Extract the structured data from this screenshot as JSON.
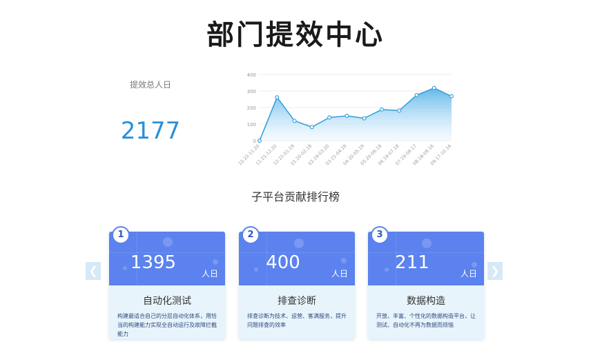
{
  "page": {
    "title": "部门提效中心"
  },
  "summary": {
    "label": "提效总人日",
    "total": "2177"
  },
  "chart_data": {
    "type": "area",
    "x": [
      "10.22-11.20",
      "11.21-12.20",
      "12.21-01.19",
      "01.20-02.18",
      "02.19-03.20",
      "03.21-04.19",
      "04.20-05.19",
      "05.20-06.18",
      "06.19-07.18",
      "07.19-08.17",
      "08.18-09.16",
      "09.17-10.16"
    ],
    "series": [
      {
        "values": [
          0,
          262,
          120,
          82,
          140,
          150,
          135,
          188,
          182,
          275,
          318,
          268
        ]
      }
    ],
    "yticks": [
      "0",
      "100",
      "200",
      "300",
      "400"
    ],
    "ylim": [
      0,
      400
    ],
    "grid": true,
    "colors": {
      "line": "#3aa0dc",
      "fill_top": "#4fb0e8",
      "fill_bottom": "#e6f4fc",
      "point_fill": "#ffffff"
    }
  },
  "ranking": {
    "title": "子平台贡献排行榜",
    "prev_icon": "chevron-left-icon",
    "next_icon": "chevron-right-icon",
    "cards": [
      {
        "rank": "1",
        "value": "1395",
        "unit": "人日",
        "name": "自动化测试",
        "desc": "构建最适合自己的分层自动化体系，用恰当的构建能力实现全自动运行及故障拦截能力"
      },
      {
        "rank": "2",
        "value": "400",
        "unit": "人日",
        "name": "排查诊断",
        "desc": "排查诊断为技术、运营、客满服务，提升问题排查的效率"
      },
      {
        "rank": "3",
        "value": "211",
        "unit": "人日",
        "name": "数据构造",
        "desc": "开放、丰富、个性化的数据构造平台，让测试、自动化不再为数据而烦恼"
      }
    ]
  },
  "colors": {
    "accent": "#2a8fd8",
    "card_header": "#5b82ee",
    "card_body": "#e8f4fc"
  }
}
